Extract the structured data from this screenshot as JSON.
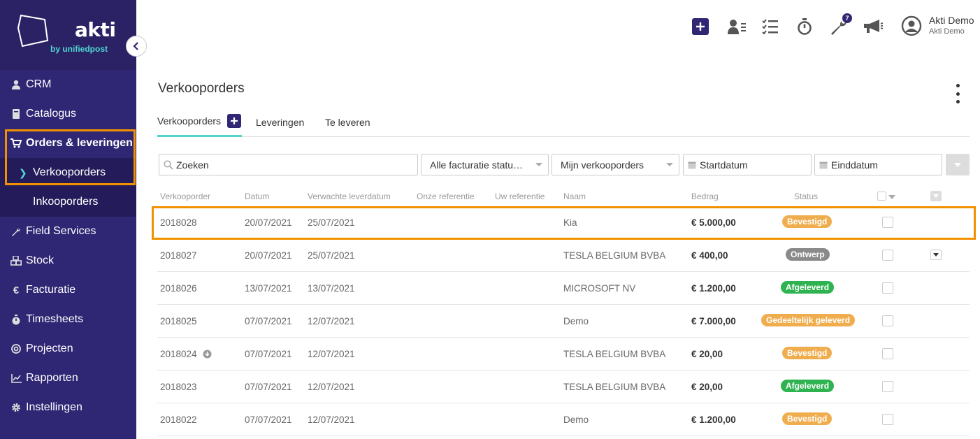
{
  "sidebar": {
    "brand": "akti",
    "brand_sub": "by unifiedpost",
    "items": [
      {
        "label": "CRM",
        "icon": "user-icon"
      },
      {
        "label": "Catalogus",
        "icon": "book-icon"
      },
      {
        "label": "Orders & leveringen",
        "icon": "cart-icon"
      },
      {
        "label": "Field Services",
        "icon": "wrench-icon"
      },
      {
        "label": "Stock",
        "icon": "cubes-icon"
      },
      {
        "label": "Facturatie",
        "icon": "euro-icon"
      },
      {
        "label": "Timesheets",
        "icon": "stopwatch-icon"
      },
      {
        "label": "Projecten",
        "icon": "target-icon"
      },
      {
        "label": "Rapporten",
        "icon": "chart-icon"
      },
      {
        "label": "Instellingen",
        "icon": "gear-icon"
      }
    ],
    "sub_items": [
      {
        "label": "Verkooporders"
      },
      {
        "label": "Inkooporders"
      }
    ]
  },
  "header": {
    "badge_count": "7",
    "user_name": "Akti Demo",
    "user_company": "Akti Demo"
  },
  "main": {
    "title": "Verkooporders",
    "tabs": [
      {
        "label": "Verkooporders"
      },
      {
        "label": "Leveringen"
      },
      {
        "label": "Te leveren"
      }
    ],
    "filters": {
      "search_placeholder": "Zoeken",
      "billing_status": "Alle facturatie statu…",
      "owner": "Mijn verkooporders",
      "start_placeholder": "Startdatum",
      "end_placeholder": "Einddatum"
    },
    "columns": [
      "Verkooporder",
      "Datum",
      "Verwachte leverdatum",
      "Onze referentie",
      "Uw referentie",
      "Naam",
      "Bedrag",
      "Status"
    ],
    "rows": [
      {
        "order": "2018028",
        "date": "20/07/2021",
        "delivery": "25/07/2021",
        "name": "Kia",
        "amount": "€ 5.000,00",
        "status": "Bevestigd"
      },
      {
        "order": "2018027",
        "date": "20/07/2021",
        "delivery": "25/07/2021",
        "name": "TESLA BELGIUM BVBA",
        "amount": "€ 400,00",
        "status": "Ontwerp"
      },
      {
        "order": "2018026",
        "date": "13/07/2021",
        "delivery": "13/07/2021",
        "name": "MICROSOFT NV",
        "amount": "€ 1.200,00",
        "status": "Afgeleverd"
      },
      {
        "order": "2018025",
        "date": "07/07/2021",
        "delivery": "12/07/2021",
        "name": "Demo",
        "amount": "€ 7.000,00",
        "status": "Gedeeltelijk geleverd"
      },
      {
        "order": "2018024",
        "date": "07/07/2021",
        "delivery": "12/07/2021",
        "name": "TESLA BELGIUM BVBA",
        "amount": "€ 20,00",
        "status": "Bevestigd"
      },
      {
        "order": "2018023",
        "date": "07/07/2021",
        "delivery": "12/07/2021",
        "name": "TESLA BELGIUM BVBA",
        "amount": "€ 20,00",
        "status": "Afgeleverd"
      },
      {
        "order": "2018022",
        "date": "07/07/2021",
        "delivery": "12/07/2021",
        "name": "Demo",
        "amount": "€ 1.200,00",
        "status": "Bevestigd"
      }
    ]
  },
  "colors": {
    "sidebar": "#2f2674",
    "accent": "#4fd6d0",
    "highlight": "#f29100",
    "status_bevestigd": "#f0ad4e",
    "status_ontwerp": "#8a8a8a",
    "status_afgeleverd": "#2fb350"
  }
}
